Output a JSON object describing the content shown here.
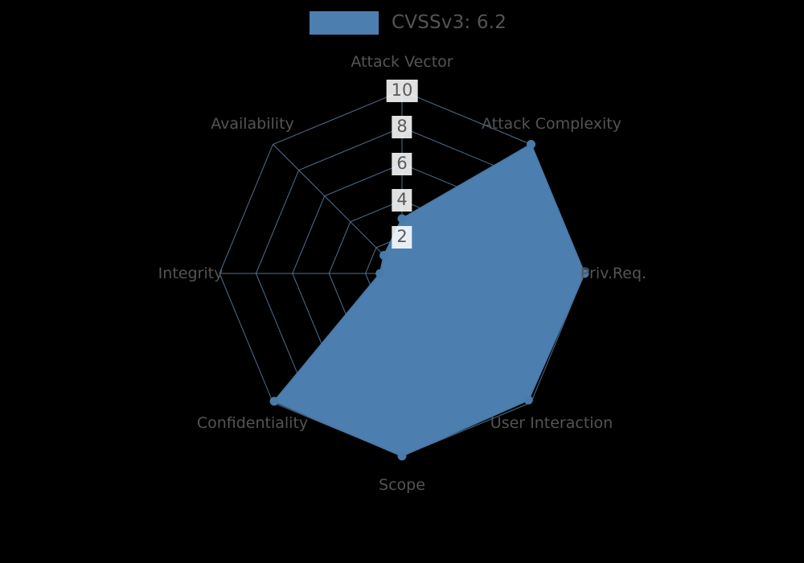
{
  "legend": {
    "label": "CVSSv3: 6.2",
    "swatch_color": "#4c7fb0",
    "icon": "legend-swatch"
  },
  "colors": {
    "background": "#000000",
    "series_fill": "#4c7fb0",
    "series_line": "#4a7aa8",
    "grid": "#4f6f8e",
    "text": "#545454",
    "tick_text": "#5a5a5a",
    "tick_bg": "#ffffff"
  },
  "chart_data": {
    "type": "radar",
    "title": "CVSSv3: 6.2",
    "xlabel": "",
    "ylabel": "",
    "rlim": [
      0,
      10
    ],
    "grid": true,
    "legend_position": "top",
    "tick_labels": [
      "2",
      "4",
      "6",
      "8",
      "10"
    ],
    "tick_values": [
      2,
      4,
      6,
      8,
      10
    ],
    "categories": [
      "Attack Vector",
      "Attack Complexity",
      "Priv.Req.",
      "User Interaction",
      "Scope",
      "Confidentiality",
      "Integrity",
      "Availability"
    ],
    "series": [
      {
        "name": "CVSSv3: 6.2",
        "values": [
          3.0,
          10.0,
          10.0,
          9.8,
          10.0,
          9.9,
          1.2,
          1.4
        ]
      }
    ]
  }
}
